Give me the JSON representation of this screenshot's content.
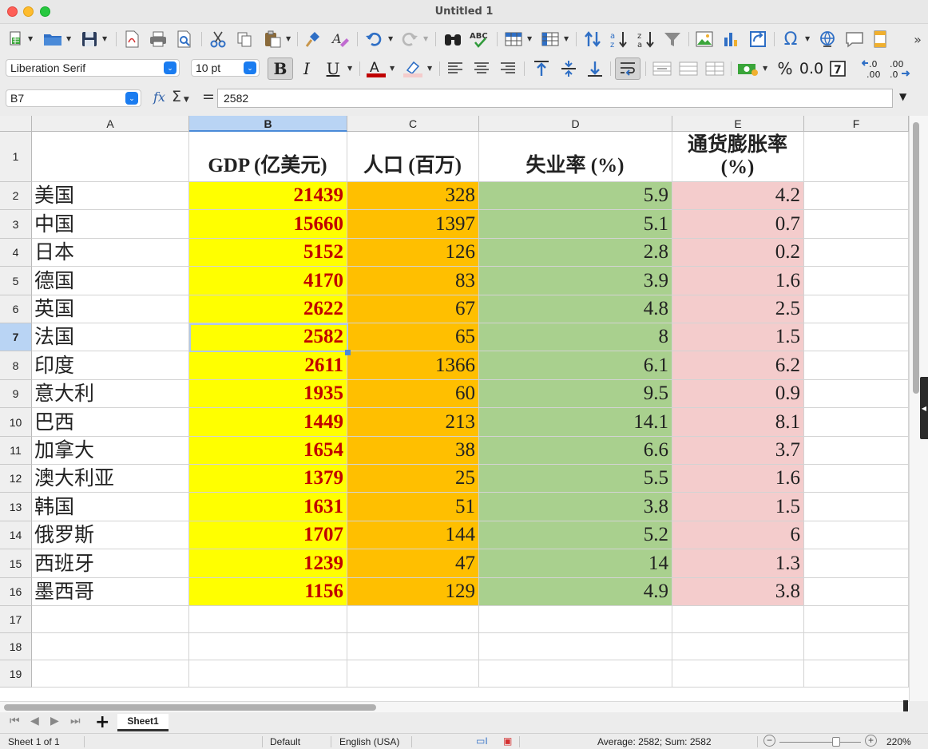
{
  "window": {
    "title": "Untitled 1"
  },
  "toolbar2": {
    "font_name": "Liberation Serif",
    "font_size": "10 pt",
    "bold_label": "B",
    "italic_label": "I",
    "underline_label": "U",
    "percent_label": "%",
    "decimal_label": "0.0"
  },
  "formula_bar": {
    "cell_ref": "B7",
    "fx_label": "fx",
    "sigma_label": "Σ",
    "equals_label": "=",
    "content": "2582"
  },
  "columns": [
    "A",
    "B",
    "C",
    "D",
    "E",
    "F"
  ],
  "rows": [
    "1",
    "2",
    "3",
    "4",
    "5",
    "6",
    "7",
    "8",
    "9",
    "10",
    "11",
    "12",
    "13",
    "14",
    "15",
    "16",
    "17",
    "18",
    "19"
  ],
  "headers": {
    "gdp": "GDP (亿美元)",
    "population": "人口 (百万)",
    "unemployment": "失业率 (%)",
    "inflation_line1": "通货膨胀率",
    "inflation_line2": "(%)"
  },
  "table": [
    {
      "country": "美国",
      "gdp": "21439",
      "population": "328",
      "unemployment": "5.9",
      "inflation": "4.2"
    },
    {
      "country": "中国",
      "gdp": "15660",
      "population": "1397",
      "unemployment": "5.1",
      "inflation": "0.7"
    },
    {
      "country": "日本",
      "gdp": "5152",
      "population": "126",
      "unemployment": "2.8",
      "inflation": "0.2"
    },
    {
      "country": "德国",
      "gdp": "4170",
      "population": "83",
      "unemployment": "3.9",
      "inflation": "1.6"
    },
    {
      "country": "英国",
      "gdp": "2622",
      "population": "67",
      "unemployment": "4.8",
      "inflation": "2.5"
    },
    {
      "country": "法国",
      "gdp": "2582",
      "population": "65",
      "unemployment": "8",
      "inflation": "1.5"
    },
    {
      "country": "印度",
      "gdp": "2611",
      "population": "1366",
      "unemployment": "6.1",
      "inflation": "6.2"
    },
    {
      "country": "意大利",
      "gdp": "1935",
      "population": "60",
      "unemployment": "9.5",
      "inflation": "0.9"
    },
    {
      "country": "巴西",
      "gdp": "1449",
      "population": "213",
      "unemployment": "14.1",
      "inflation": "8.1"
    },
    {
      "country": "加拿大",
      "gdp": "1654",
      "population": "38",
      "unemployment": "6.6",
      "inflation": "3.7"
    },
    {
      "country": "澳大利亚",
      "gdp": "1379",
      "population": "25",
      "unemployment": "5.5",
      "inflation": "1.6"
    },
    {
      "country": "韩国",
      "gdp": "1631",
      "population": "51",
      "unemployment": "3.8",
      "inflation": "1.5"
    },
    {
      "country": "俄罗斯",
      "gdp": "1707",
      "population": "144",
      "unemployment": "5.2",
      "inflation": "6"
    },
    {
      "country": "西班牙",
      "gdp": "1239",
      "population": "47",
      "unemployment": "14",
      "inflation": "1.3"
    },
    {
      "country": "墨西哥",
      "gdp": "1156",
      "population": "129",
      "unemployment": "4.9",
      "inflation": "3.8"
    }
  ],
  "selection": {
    "column": "B",
    "row": "7"
  },
  "colors": {
    "gdp_fill": "#ffff00",
    "gdp_text": "#c00000",
    "population_fill": "#ffbf00",
    "unemployment_fill": "#a9d08e",
    "inflation_fill": "#f4cccc"
  },
  "sheet_tabs": {
    "active": "Sheet1"
  },
  "status_bar": {
    "sheet_info": "Sheet 1 of 1",
    "page_style": "Default",
    "language": "English (USA)",
    "summary": "Average: 2582; Sum: 2582",
    "zoom": "220%"
  }
}
